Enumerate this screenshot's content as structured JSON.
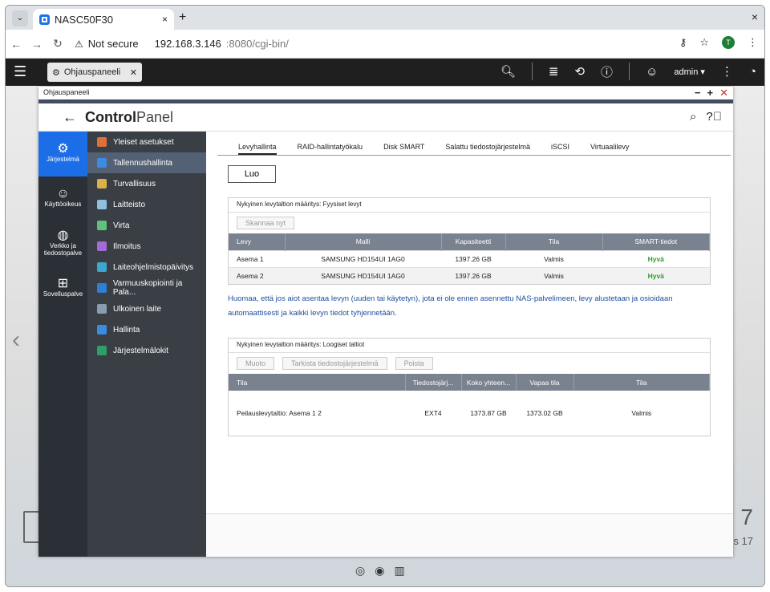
{
  "browser": {
    "tab_title": "NASC50F30",
    "new_tab": "+",
    "close": "×",
    "not_secure": "Not secure",
    "url_host": "192.168.3.146",
    "url_path": ":8080/cgi-bin/",
    "profile_initial": "T"
  },
  "qts": {
    "tab_label": "Ohjauspaneeli",
    "user": "admin ▾"
  },
  "window": {
    "title": "Ohjauspaneeli",
    "app_title_bold": "Control",
    "app_title_light": "Panel"
  },
  "rail": [
    {
      "label": "Järjestelmä"
    },
    {
      "label": "Käyttöoikeus"
    },
    {
      "label": "Verkko ja tiedostopalve"
    },
    {
      "label": "Sovelluspalve"
    }
  ],
  "menu": [
    {
      "label": "Yleiset asetukset",
      "color": "#e0703a"
    },
    {
      "label": "Tallennushallinta",
      "color": "#3b8be0"
    },
    {
      "label": "Turvallisuus",
      "color": "#d9b04a"
    },
    {
      "label": "Laitteisto",
      "color": "#8fc0e0"
    },
    {
      "label": "Virta",
      "color": "#5ec27a"
    },
    {
      "label": "Ilmoitus",
      "color": "#a56ad6"
    },
    {
      "label": "Laiteohjelmistopäivitys",
      "color": "#3aa8d0"
    },
    {
      "label": "Varmuuskopiointi ja Pala...",
      "color": "#2f7fd6"
    },
    {
      "label": "Ulkoinen laite",
      "color": "#8a9db0"
    },
    {
      "label": "Hallinta",
      "color": "#3b8be0"
    },
    {
      "label": "Järjestelmälokit",
      "color": "#2e9e6a"
    }
  ],
  "tabs": [
    "Levyhallinta",
    "RAID-hallintatyökalu",
    "Disk SMART",
    "Salattu tiedostojärjestelmä",
    "iSCSI",
    "Virtuaalilevy"
  ],
  "luo": "Luo",
  "physical": {
    "title": "Nykyinen levytaltion määritys: Fyysiset levyt",
    "scan": "Skannaa nyt",
    "headers": [
      "Levy",
      "Malli",
      "Kapasiteetti",
      "Tila",
      "SMART-tiedot"
    ],
    "rows": [
      [
        "Asema 1",
        "SAMSUNG HD154UI 1AG0",
        "1397.26 GB",
        "Valmis",
        "Hyvä"
      ],
      [
        "Asema 2",
        "SAMSUNG HD154UI 1AG0",
        "1397.26 GB",
        "Valmis",
        "Hyvä"
      ]
    ]
  },
  "note": "Huomaa, että jos aiot asentaa levyn (uuden tai käytetyn), jota ei ole ennen asennettu NAS-palvelimeen, levy alustetaan ja osioidaan automaattisesti ja kaikki levyn tiedot tyhjennetään.",
  "logical": {
    "title": "Nykyinen levytaltion määritys: Loogiset taltiot",
    "buttons": [
      "Muoto",
      "Tarkista tiedostojärjestelmä",
      "Poista"
    ],
    "headers": [
      "Tila",
      "Tiedostojärj...",
      "Koko yhteen...",
      "Vapaa tila",
      "Tila"
    ],
    "rows": [
      [
        "Peilauslevytaltio: Asema 1 2",
        "EXT4",
        "1373.87 GB",
        "1373.02 GB",
        "Valmis"
      ]
    ]
  },
  "desktop": {
    "clock_partial": "7",
    "date_partial": "s 17"
  }
}
